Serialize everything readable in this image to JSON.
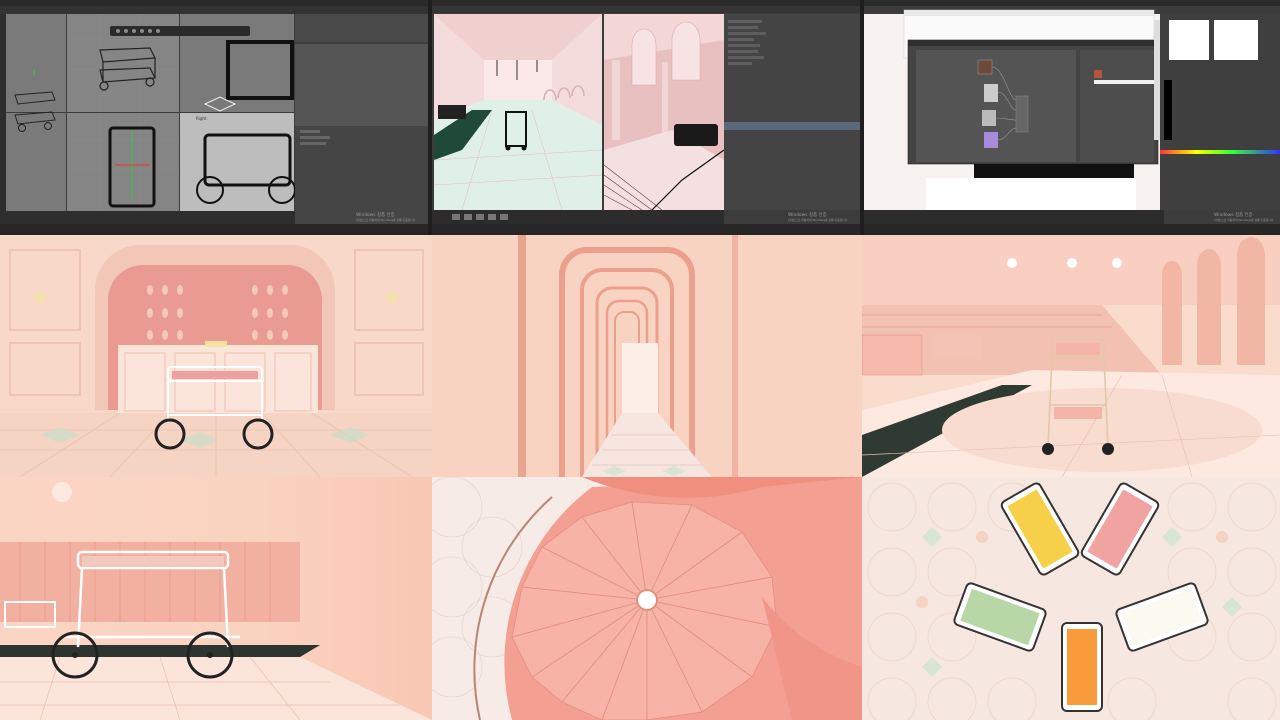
{
  "screens": {
    "screen1": {
      "viewport_label": "Right",
      "watermark_title": "Windows 정품 인증",
      "watermark_sub": "[설정]으로 이동하여 Windows를 정품 인증합니다."
    },
    "screen2": {
      "watermark_title": "Windows 정품 인증",
      "watermark_sub": "[설정]으로 이동하여 Windows를 정품 인증합니다."
    },
    "screen3": {
      "watermark_title": "Windows 정품 인증",
      "watermark_sub": "[설정]으로 이동하여 Windows를 정품 인증합니다."
    }
  },
  "colors": {
    "ui_dark": "#3a3a3a",
    "ui_panel": "#4a4a4a",
    "viewport_grey": "#7d7d7d",
    "pink_light": "#f9d8cc",
    "pink_mid": "#f0a898",
    "pink_deep": "#e87f72",
    "floor_green": "#2d4a3a"
  },
  "icons": [
    "cart-icon",
    "node-icon",
    "window-icon"
  ]
}
